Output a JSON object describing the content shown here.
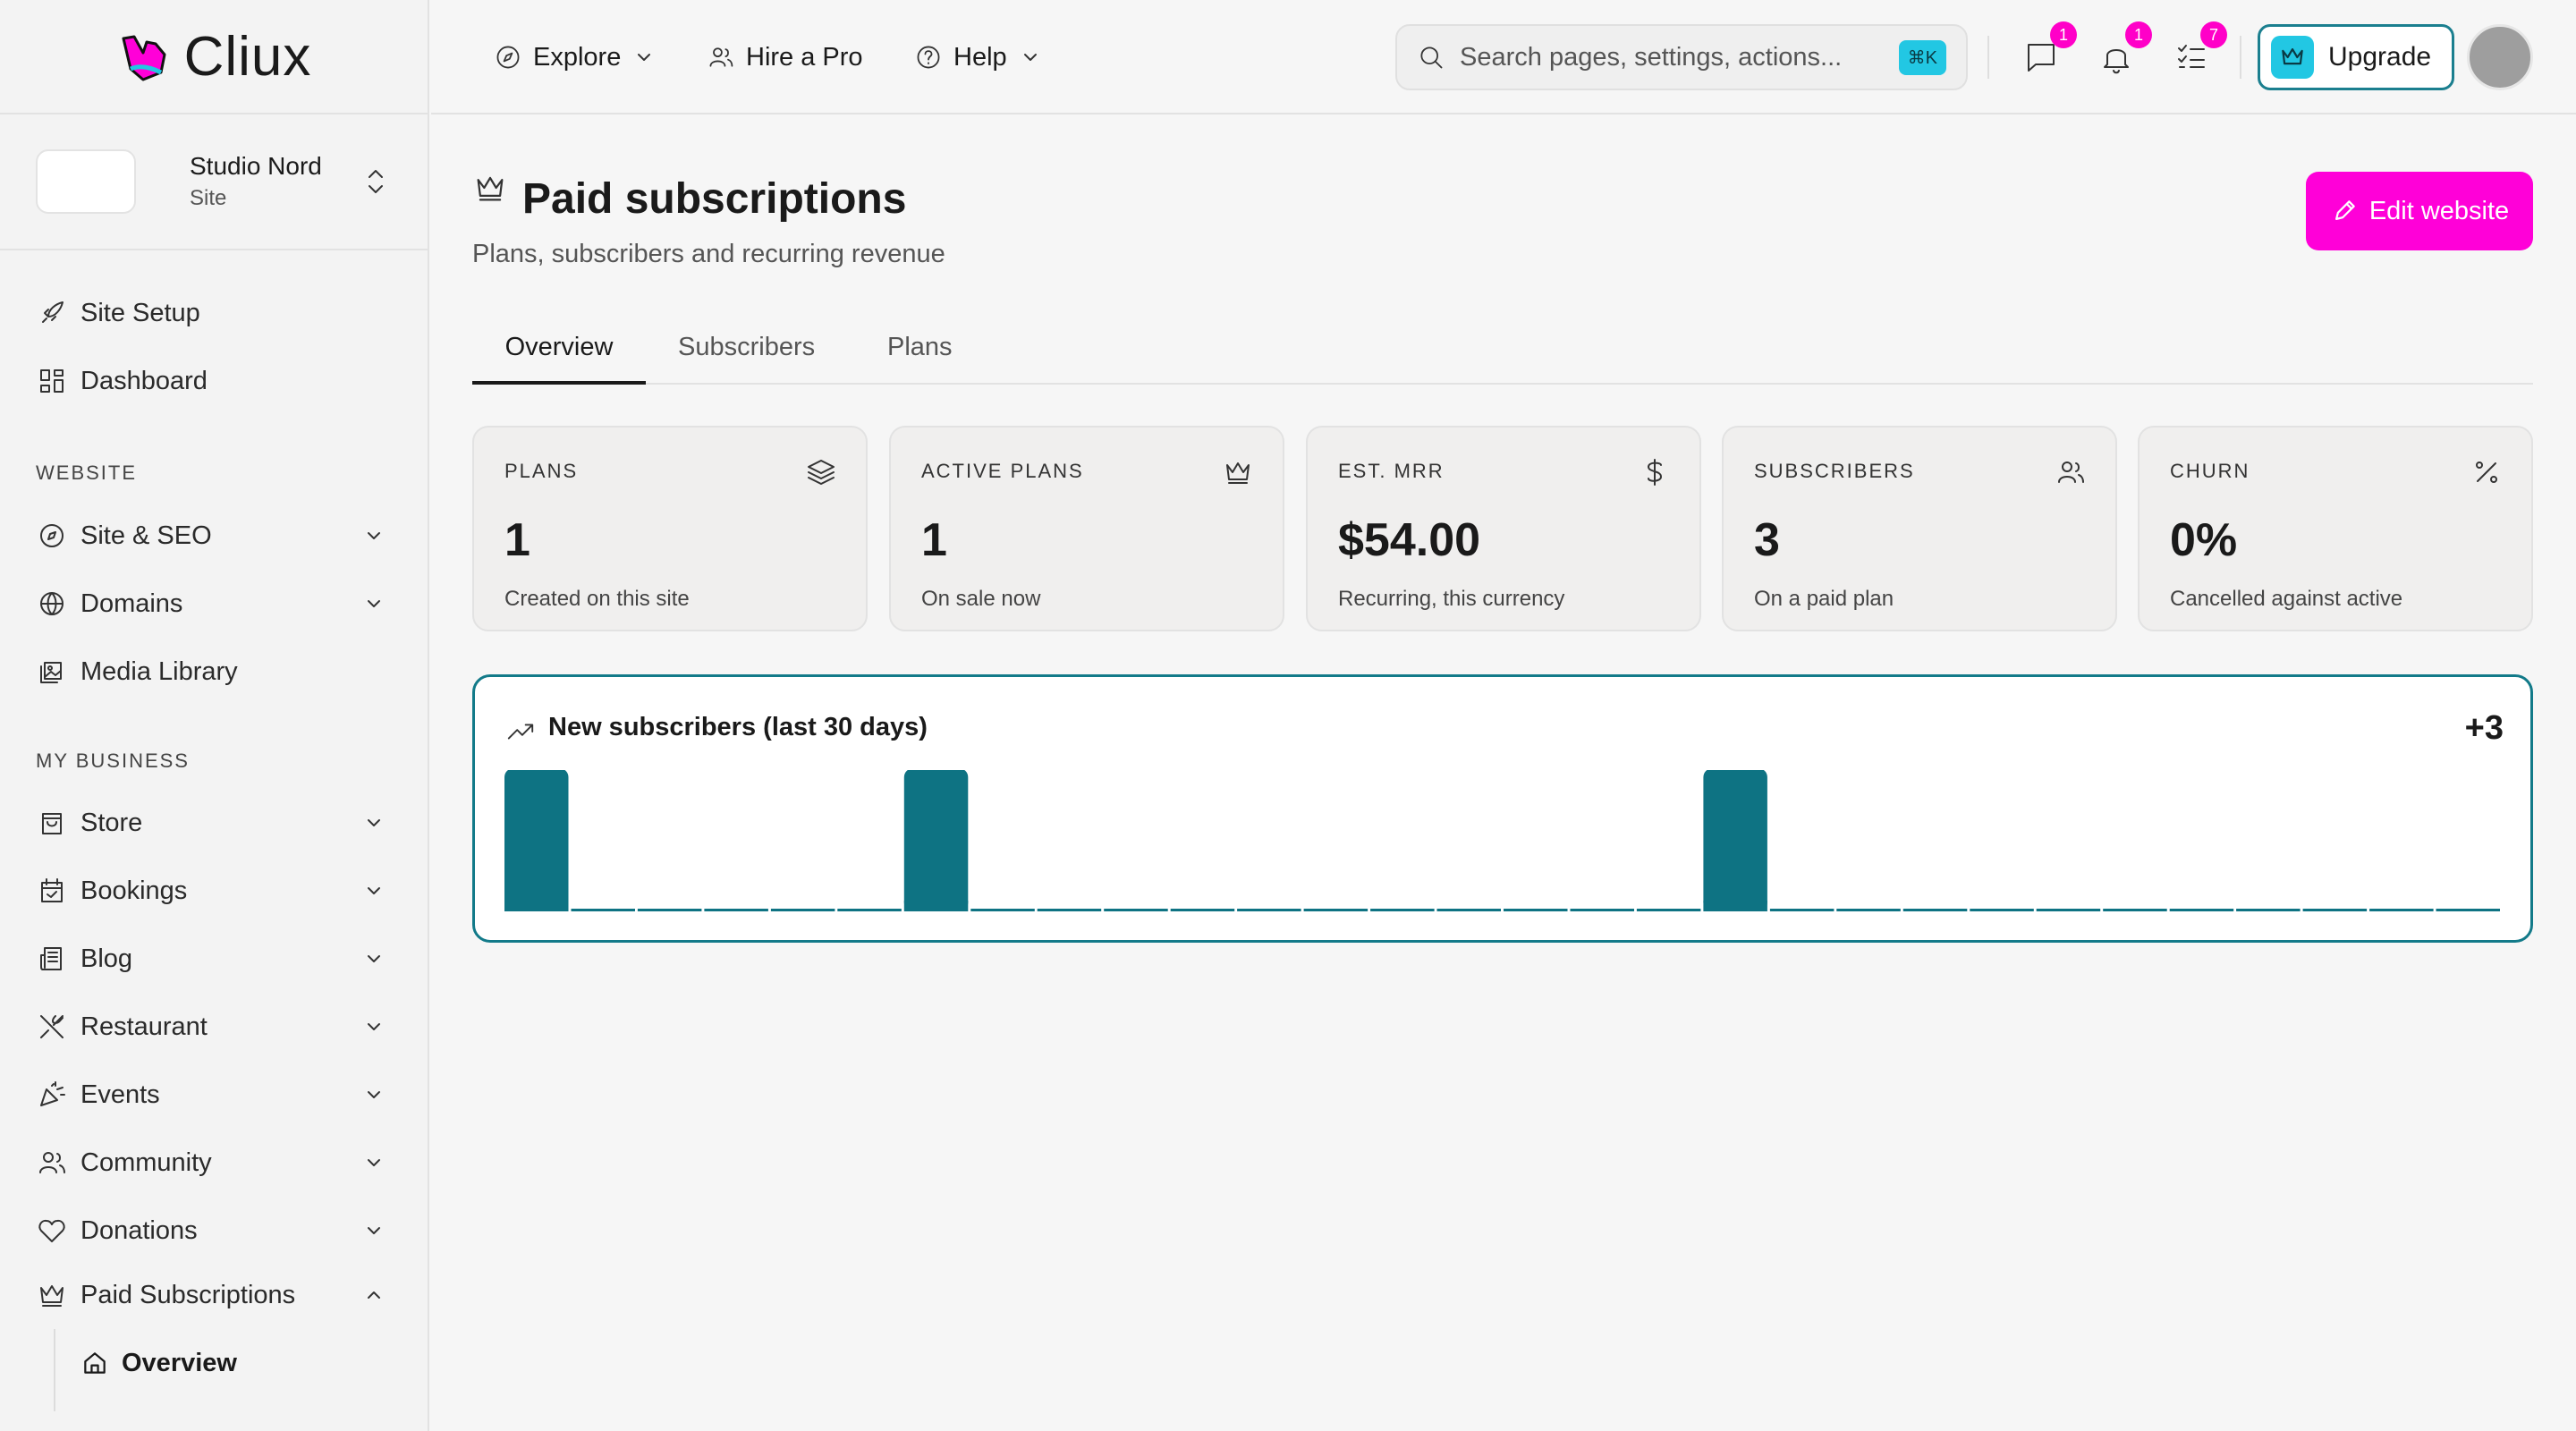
{
  "app": {
    "brand": "Cliux"
  },
  "site": {
    "name": "Studio Nord",
    "type": "Site"
  },
  "sidebar": {
    "top_items": [
      {
        "label": "Site Setup",
        "icon": "rocket-icon"
      },
      {
        "label": "Dashboard",
        "icon": "dashboard-icon"
      }
    ],
    "sections": [
      {
        "title": "WEBSITE",
        "items": [
          {
            "label": "Site & SEO",
            "icon": "compass-icon"
          },
          {
            "label": "Domains",
            "icon": "globe-icon"
          },
          {
            "label": "Media Library",
            "icon": "image-icon"
          }
        ]
      },
      {
        "title": "MY BUSINESS",
        "items": [
          {
            "label": "Store",
            "icon": "shopping-bag-icon"
          },
          {
            "label": "Bookings",
            "icon": "calendar-icon"
          },
          {
            "label": "Blog",
            "icon": "newspaper-icon"
          },
          {
            "label": "Restaurant",
            "icon": "utensils-icon"
          },
          {
            "label": "Events",
            "icon": "party-popper-icon"
          },
          {
            "label": "Community",
            "icon": "users-icon"
          },
          {
            "label": "Donations",
            "icon": "heart-icon"
          },
          {
            "label": "Paid Subscriptions",
            "icon": "crown-icon"
          }
        ]
      }
    ],
    "sub_item": {
      "label": "Overview",
      "icon": "home-icon"
    }
  },
  "topbar": {
    "explore": "Explore",
    "hire": "Hire a Pro",
    "help": "Help",
    "search_placeholder": "Search pages, settings, actions...",
    "search_kbd": "⌘K",
    "badges": {
      "messages": "1",
      "notifications": "1",
      "tasks": "7"
    },
    "upgrade": "Upgrade"
  },
  "page": {
    "title": "Paid subscriptions",
    "subtitle": "Plans, subscribers and recurring revenue",
    "edit_button": "Edit website",
    "tabs": [
      "Overview",
      "Subscribers",
      "Plans"
    ],
    "active_tab": "Overview"
  },
  "stats": [
    {
      "label": "PLANS",
      "value": "1",
      "desc": "Created on this site",
      "icon": "layers-icon"
    },
    {
      "label": "ACTIVE PLANS",
      "value": "1",
      "desc": "On sale now",
      "icon": "crown-icon"
    },
    {
      "label": "EST. MRR",
      "value": "$54.00",
      "desc": "Recurring, this currency",
      "icon": "dollar-icon"
    },
    {
      "label": "SUBSCRIBERS",
      "value": "3",
      "desc": "On a paid plan",
      "icon": "users-icon"
    },
    {
      "label": "CHURN",
      "value": "0%",
      "desc": "Cancelled against active",
      "icon": "percent-icon"
    }
  ],
  "colors": {
    "accent": "#ff00d8",
    "teal": "#127a89",
    "bar": "#0e7383",
    "cyan": "#22c7e3"
  },
  "chart_data": {
    "type": "bar",
    "title": "New subscribers (last 30 days)",
    "total": "+3",
    "xlabel": "",
    "ylabel": "",
    "values": [
      1,
      0,
      0,
      0,
      0,
      0,
      1,
      0,
      0,
      0,
      0,
      0,
      0,
      0,
      0,
      0,
      0,
      0,
      1,
      0,
      0,
      0,
      0,
      0,
      0,
      0,
      0,
      0,
      0,
      0
    ],
    "ylim": [
      0,
      1
    ]
  }
}
